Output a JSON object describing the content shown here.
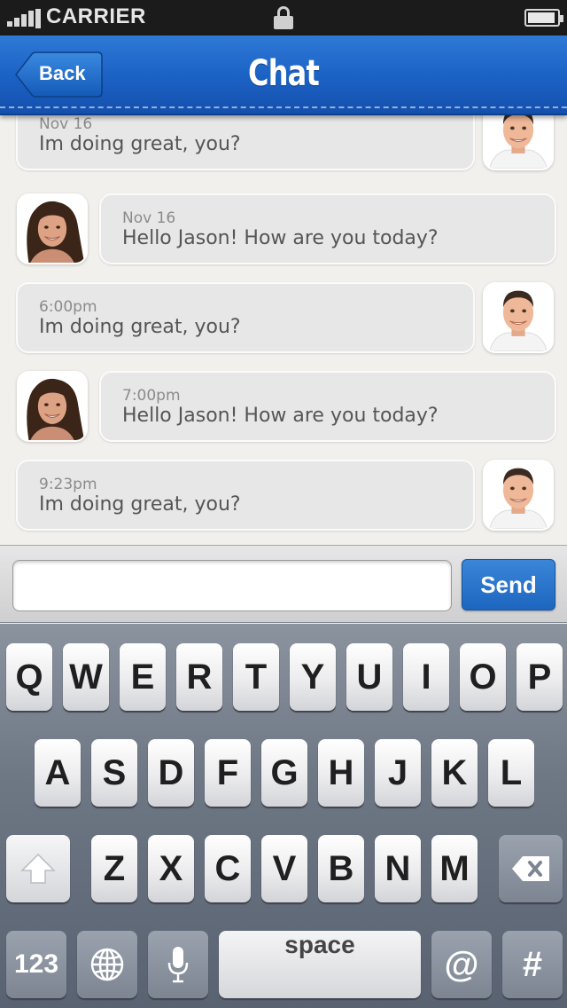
{
  "status_bar": {
    "carrier": "CARRIER",
    "battery_level": 0.95
  },
  "nav": {
    "back_label": "Back",
    "title": "Chat"
  },
  "messages": [
    {
      "direction": "out",
      "timestamp": "Nov 16",
      "text": "Im doing great, you?"
    },
    {
      "direction": "in",
      "timestamp": "Nov 16",
      "text": "Hello Jason! How are you today?"
    },
    {
      "direction": "out",
      "timestamp": "6:00pm",
      "text": "Im doing great, you?"
    },
    {
      "direction": "in",
      "timestamp": "7:00pm",
      "text": "Hello Jason! How are you today?"
    },
    {
      "direction": "out",
      "timestamp": "9:23pm",
      "text": "Im doing great, you?"
    }
  ],
  "composer": {
    "input_value": "",
    "send_label": "Send"
  },
  "keyboard": {
    "row1": [
      "Q",
      "W",
      "E",
      "R",
      "T",
      "Y",
      "U",
      "I",
      "O",
      "P"
    ],
    "row2": [
      "A",
      "S",
      "D",
      "F",
      "G",
      "H",
      "J",
      "K",
      "L"
    ],
    "row3": [
      "Z",
      "X",
      "C",
      "V",
      "B",
      "N",
      "M"
    ],
    "numbers_label": "123",
    "space_label": "space",
    "at_label": "@",
    "hash_label": "#",
    "shift_icon": "shift-arrow-icon",
    "delete_icon": "backspace-icon",
    "globe_icon": "globe-icon",
    "mic_icon": "microphone-icon"
  },
  "colors": {
    "nav_blue": "#1c63c6",
    "send_blue": "#2a76cc",
    "bubble": "#e7e7e7"
  }
}
